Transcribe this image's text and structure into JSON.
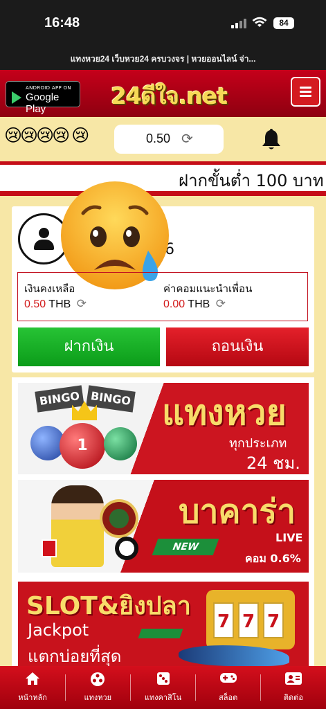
{
  "status_bar": {
    "time": "16:48",
    "battery": "84",
    "url": "แทงหวย24 เว็บหวย24 ครบวงจร | หวยออนไลน์ จ่า..."
  },
  "header": {
    "store_badge_small": "ANDROID APP ON",
    "store_badge_label": "Google Play",
    "logo": "24ดีใจ.net"
  },
  "balance_bar": {
    "emojis": "😢😢😢😢 😢",
    "balance": "0.50"
  },
  "marquee": "ฝากขั้นต่ำ 100 บาท",
  "profile": {
    "username_fragment": "6",
    "balance_label": "เงินคงเหลือ",
    "balance_value": "0.50",
    "balance_unit": "THB",
    "commission_label": "ค่าคอมแนะนำเพื่อน",
    "commission_value": "0.00",
    "commission_unit": "THB",
    "deposit_button": "ฝากเงิน",
    "withdraw_button": "ถอนเงิน"
  },
  "banners": {
    "lottery": {
      "bingo1": "BINGO",
      "bingo2": "BINGO",
      "ball_number": "1",
      "title": "แทงหวย",
      "sub1": "ทุกประเภท",
      "sub2": "24 ชม."
    },
    "baccarat": {
      "title": "บาคาร่า",
      "badge": "NEW",
      "live": "LIVE",
      "commission": "คอม 0.6%"
    },
    "slot": {
      "title": "SLOT&ยิงปลา",
      "line1": "Jackpot",
      "line2": "แตกบ่อยที่สุด",
      "reels": [
        "7",
        "7",
        "7"
      ]
    }
  },
  "bottom_nav": [
    {
      "label": "หน้าหลัก",
      "icon": "home-icon"
    },
    {
      "label": "แทงหวย",
      "icon": "lottery-ball-icon"
    },
    {
      "label": "แทงคาสิโน",
      "icon": "dice-icon"
    },
    {
      "label": "สล็อต",
      "icon": "gamepad-icon"
    },
    {
      "label": "ติดต่อ",
      "icon": "contact-card-icon"
    }
  ],
  "colors": {
    "brand_red": "#c50d18",
    "page_bg": "#f7e7a6",
    "deposit_green": "#17b026",
    "logo_gold": "#f6d956"
  }
}
